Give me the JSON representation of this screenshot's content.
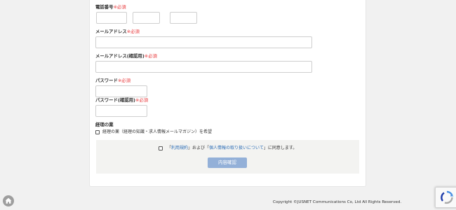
{
  "form": {
    "required_mark": "※必須",
    "phone_label": "電話番号",
    "email_label": "メールアドレス",
    "email_confirm_label": "メールアドレス(確認用)",
    "password_label": "パスワード",
    "password_confirm_label": "パスワード(確認用)",
    "newsletter": {
      "label": "経理の薬",
      "option": "経理の薬（経理の知識・求人情報メールマガジン）を希望"
    },
    "agreement": {
      "prefix": "「",
      "terms_link": "利用規約",
      "middle": "」および「",
      "privacy_link": "個人情報の取り扱いについて",
      "suffix": "」に同意します。"
    },
    "submit_label": "内容確認"
  },
  "footer": {
    "copyright": "Copyright ©JUSNET Communications Co, Ltd All Rights Reserved."
  },
  "icons": {
    "home": "home-icon",
    "recaptcha": "recaptcha-icon"
  }
}
